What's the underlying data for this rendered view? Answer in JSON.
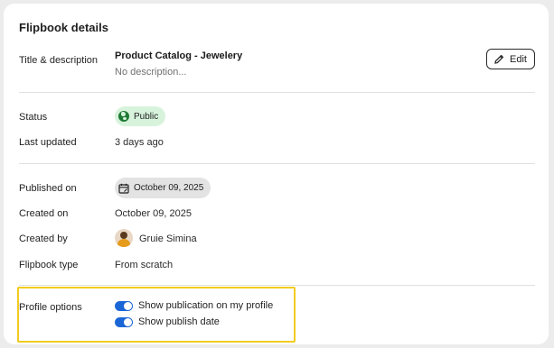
{
  "card": {
    "title": "Flipbook details"
  },
  "title_section": {
    "label": "Title & description",
    "title": "Product Catalog - Jewelery",
    "description": "No description...",
    "edit_label": "Edit"
  },
  "status_section": {
    "status_label": "Status",
    "status_value": "Public",
    "last_updated_label": "Last updated",
    "last_updated_value": "3 days ago"
  },
  "meta_section": {
    "published_label": "Published on",
    "published_value": "October 09, 2025",
    "created_on_label": "Created on",
    "created_on_value": "October 09, 2025",
    "created_by_label": "Created by",
    "created_by_value": "Gruie Simina",
    "type_label": "Flipbook type",
    "type_value": "From scratch"
  },
  "profile_options": {
    "label": "Profile options",
    "options": [
      {
        "label": "Show publication on my profile",
        "enabled": true
      },
      {
        "label": "Show publish date",
        "enabled": true
      }
    ]
  },
  "colors": {
    "accent": "#1a66d6",
    "public_badge_bg": "#d7f3dc",
    "globe": "#1e7a35",
    "highlight": "#f2cb1f"
  },
  "icons": {
    "edit": "pencil-icon",
    "status": "globe-icon",
    "published": "calendar-icon"
  }
}
